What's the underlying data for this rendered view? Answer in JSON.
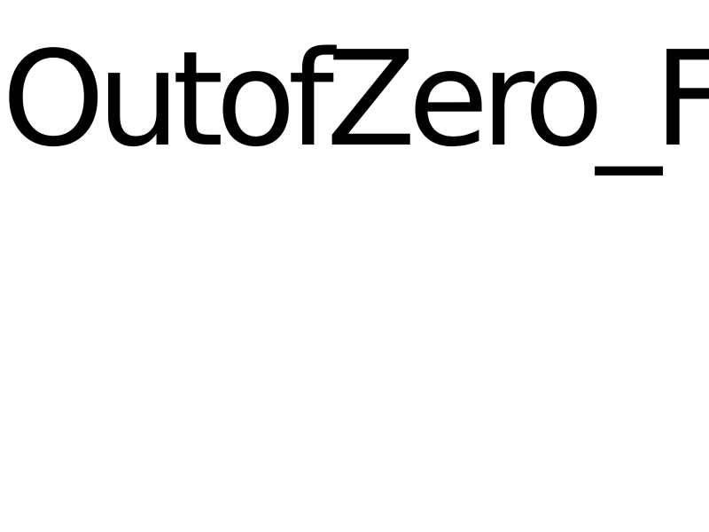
{
  "headline": {
    "text": "OutofZero_F",
    "color": "#000000"
  },
  "background_color": "#ffffff"
}
